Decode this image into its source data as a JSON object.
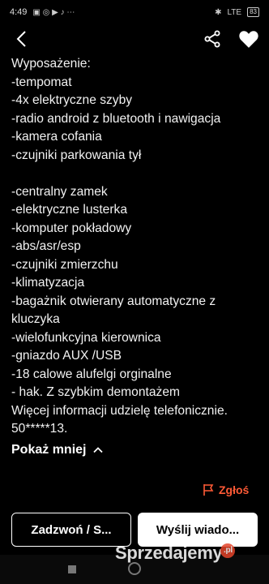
{
  "status_bar": {
    "time": "4:49",
    "network_label": "LTE",
    "battery": "83"
  },
  "description_lines": [
    "Wyposażenie:",
    "-tempomat",
    "-4x elektryczne szyby",
    "-radio android z bluetooth i nawigacja",
    "-kamera cofania",
    "-czujniki parkowania tył",
    "",
    "-centralny zamek",
    "-elektryczne lusterka",
    "-komputer pokładowy",
    "-abs/asr/esp",
    "-czujniki zmierzchu",
    "-klimatyzacja",
    "-bagażnik otwierany automatyczne z",
    "kluczyka",
    "-wielofunkcyjna kierownica",
    "-gniazdo AUX /USB",
    "-18 calowe alufelgi orginalne",
    "- hak. Z szybkim demontażem",
    "Więcej informacji udzielę telefonicznie.",
    "50*****13."
  ],
  "show_less_label": "Pokaż mniej",
  "report_label": "Zgłoś",
  "call_button_label": "Zadzwoń / S...",
  "message_button_label": "Wyślij wiado...",
  "watermark": {
    "text": "Sprzedajemy",
    "suffix": ".pl"
  },
  "colors": {
    "accent": "#ff5a36",
    "background": "#000000"
  },
  "icons": [
    "back-arrow-icon",
    "share-icon",
    "heart-icon",
    "chevron-up-icon",
    "flag-icon"
  ]
}
